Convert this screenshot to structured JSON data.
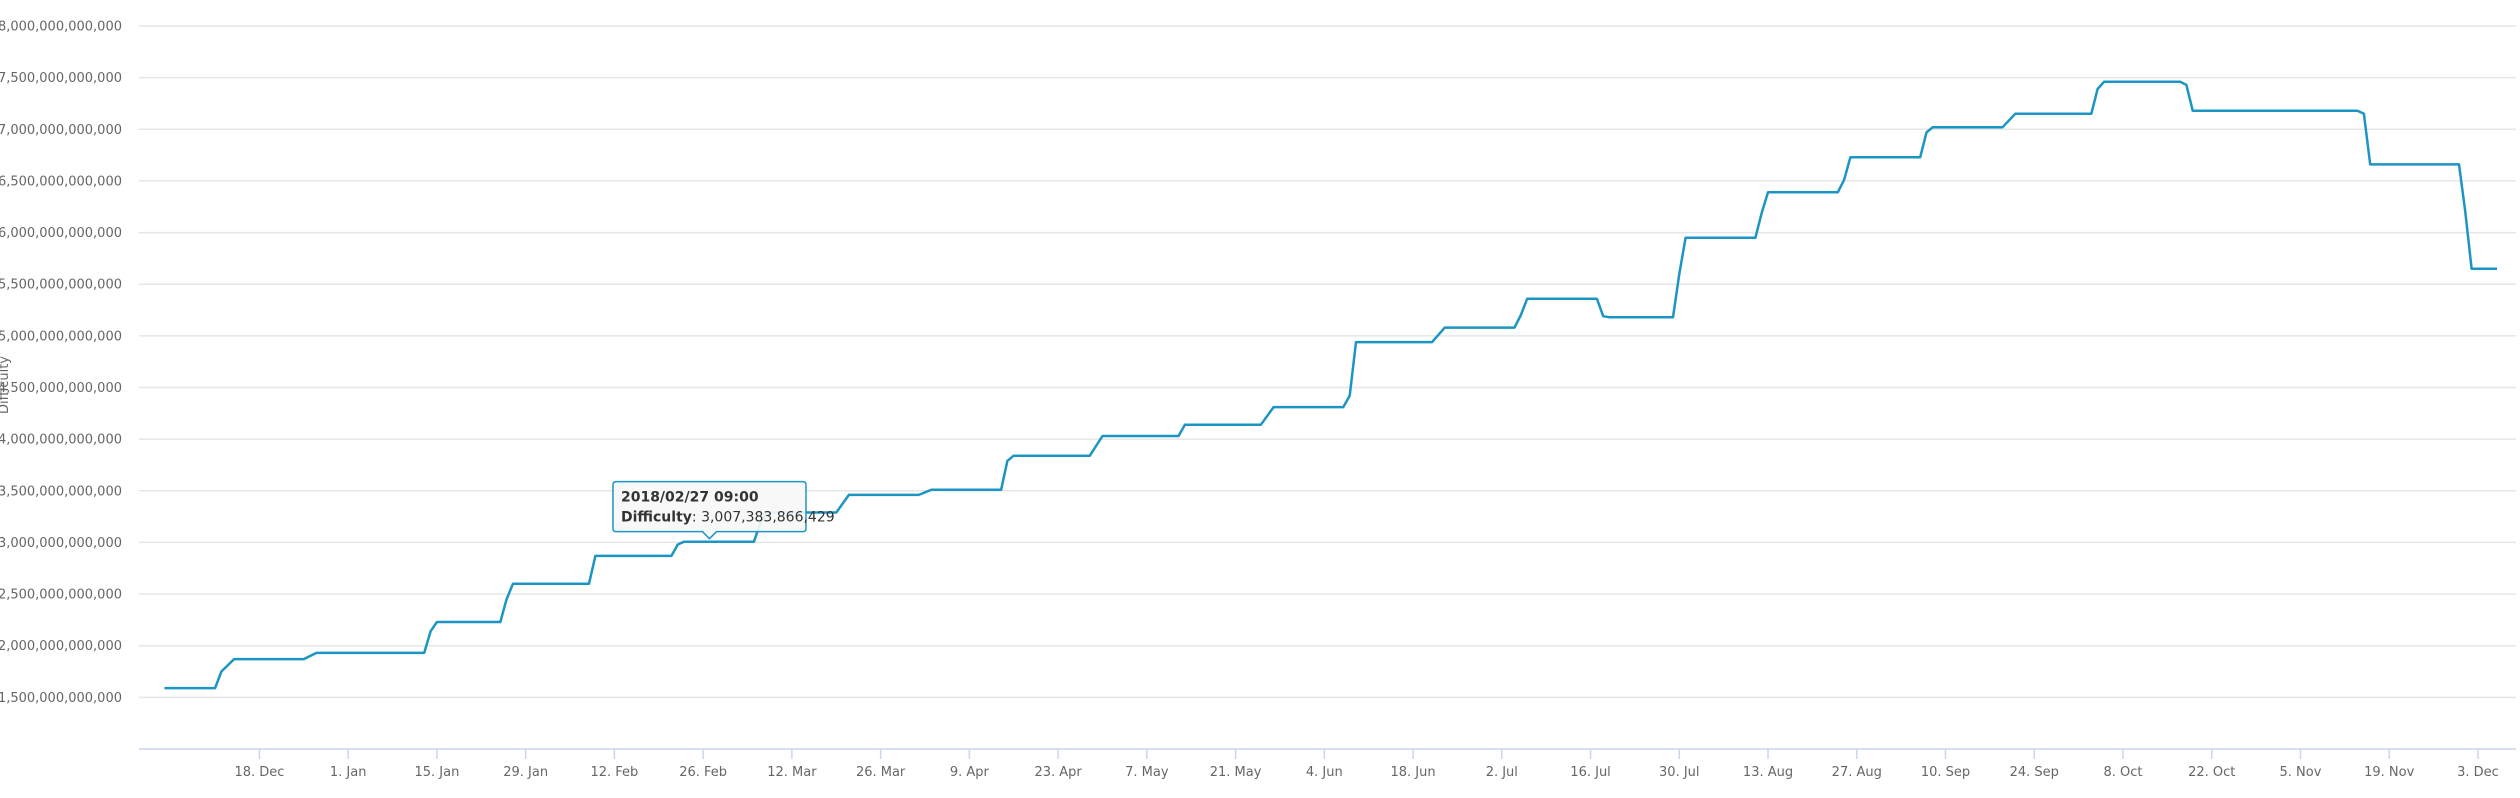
{
  "colors": {
    "series": "#1d95c4",
    "grid": "#e6e6e6",
    "axis": "#ccd6eb",
    "text": "#666666"
  },
  "chart_data": {
    "type": "line",
    "title": "",
    "xlabel": "",
    "ylabel": "Difficulty",
    "ylim": [
      1000000000000,
      8000000000000
    ],
    "xlim": [
      "2017-11-29",
      "2018-12-09"
    ],
    "grid": true,
    "legend": "none",
    "y_ticks": [
      1500000000000,
      2000000000000,
      2500000000000,
      3000000000000,
      3500000000000,
      4000000000000,
      4500000000000,
      5000000000000,
      5500000000000,
      6000000000000,
      6500000000000,
      7000000000000,
      7500000000000,
      8000000000000
    ],
    "y_tick_labels": [
      "1,500,000,000,000",
      "2,000,000,000,000",
      "2,500,000,000,000",
      "3,000,000,000,000",
      "3,500,000,000,000",
      "4,000,000,000,000",
      "4,500,000,000,000",
      "5,000,000,000,000",
      "5,500,000,000,000",
      "6,000,000,000,000",
      "6,500,000,000,000",
      "7,000,000,000,000",
      "7,500,000,000,000",
      "8,000,000,000,000"
    ],
    "x_ticks": [
      "2017-12-18",
      "2018-01-01",
      "2018-01-15",
      "2018-01-29",
      "2018-02-12",
      "2018-02-26",
      "2018-03-12",
      "2018-03-26",
      "2018-04-09",
      "2018-04-23",
      "2018-05-07",
      "2018-05-21",
      "2018-06-04",
      "2018-06-18",
      "2018-07-02",
      "2018-07-16",
      "2018-07-30",
      "2018-08-13",
      "2018-08-27",
      "2018-09-10",
      "2018-09-24",
      "2018-10-08",
      "2018-10-22",
      "2018-11-05",
      "2018-11-19",
      "2018-12-03"
    ],
    "x_tick_labels": [
      "18. Dec",
      "1. Jan",
      "15. Jan",
      "29. Jan",
      "12. Feb",
      "26. Feb",
      "12. Mar",
      "26. Mar",
      "9. Apr",
      "23. Apr",
      "7. May",
      "21. May",
      "4. Jun",
      "18. Jun",
      "2. Jul",
      "16. Jul",
      "30. Jul",
      "13. Aug",
      "27. Aug",
      "10. Sep",
      "24. Sep",
      "8. Oct",
      "22. Oct",
      "5. Nov",
      "19. Nov",
      "3. Dec"
    ],
    "series": [
      {
        "name": "Difficulty",
        "x": [
          "2017-12-03",
          "2017-12-11",
          "2017-12-12",
          "2017-12-14",
          "2017-12-25",
          "2017-12-27",
          "2018-01-13",
          "2018-01-14",
          "2018-01-15",
          "2018-01-25",
          "2018-01-26",
          "2018-01-27",
          "2018-02-08",
          "2018-02-09",
          "2018-02-21",
          "2018-02-22",
          "2018-02-23",
          "2018-03-06",
          "2018-03-07",
          "2018-03-08",
          "2018-03-12",
          "2018-03-13",
          "2018-03-19",
          "2018-03-21",
          "2018-04-01",
          "2018-04-03",
          "2018-04-14",
          "2018-04-15",
          "2018-04-16",
          "2018-04-28",
          "2018-04-30",
          "2018-05-12",
          "2018-05-13",
          "2018-05-25",
          "2018-05-27",
          "2018-06-07",
          "2018-06-08",
          "2018-06-09",
          "2018-06-21",
          "2018-06-23",
          "2018-07-04",
          "2018-07-05",
          "2018-07-06",
          "2018-07-17",
          "2018-07-18",
          "2018-07-19",
          "2018-07-29",
          "2018-07-30",
          "2018-07-31",
          "2018-08-11",
          "2018-08-12",
          "2018-08-13",
          "2018-08-24",
          "2018-08-25",
          "2018-08-26",
          "2018-09-06",
          "2018-09-07",
          "2018-09-08",
          "2018-09-19",
          "2018-09-21",
          "2018-10-03",
          "2018-10-04",
          "2018-10-05",
          "2018-10-17",
          "2018-10-18",
          "2018-10-19",
          "2018-11-14",
          "2018-11-15",
          "2018-11-16",
          "2018-11-30",
          "2018-12-01",
          "2018-12-02",
          "2018-12-06"
        ],
        "values": [
          1590000000000,
          1590000000000,
          1750000000000,
          1870000000000,
          1870000000000,
          1930000000000,
          1930000000000,
          2140000000000,
          2230000000000,
          2230000000000,
          2450000000000,
          2600000000000,
          2600000000000,
          2870000000000,
          2870000000000,
          2980000000000,
          3007383866429,
          3007383866429,
          3180000000000,
          3290000000000,
          3290000000000,
          3290000000000,
          3290000000000,
          3460000000000,
          3460000000000,
          3510000000000,
          3510000000000,
          3790000000000,
          3840000000000,
          3840000000000,
          4030000000000,
          4030000000000,
          4140000000000,
          4140000000000,
          4310000000000,
          4310000000000,
          4420000000000,
          4940000000000,
          4940000000000,
          5080000000000,
          5080000000000,
          5200000000000,
          5360000000000,
          5360000000000,
          5190000000000,
          5180000000000,
          5180000000000,
          5600000000000,
          5950000000000,
          5950000000000,
          6190000000000,
          6390000000000,
          6390000000000,
          6510000000000,
          6730000000000,
          6730000000000,
          6970000000000,
          7020000000000,
          7020000000000,
          7150000000000,
          7150000000000,
          7390000000000,
          7460000000000,
          7460000000000,
          7430000000000,
          7180000000000,
          7180000000000,
          7150000000000,
          6660000000000,
          6660000000000,
          6200000000000,
          5650000000000,
          5650000000000
        ]
      }
    ],
    "tooltip": {
      "title": "2018/02/27 09:00",
      "label": "Difficulty",
      "separator": ": ",
      "value": "3,007,383,866,429",
      "x": "2018-02-27",
      "y": 3007383866429
    }
  }
}
